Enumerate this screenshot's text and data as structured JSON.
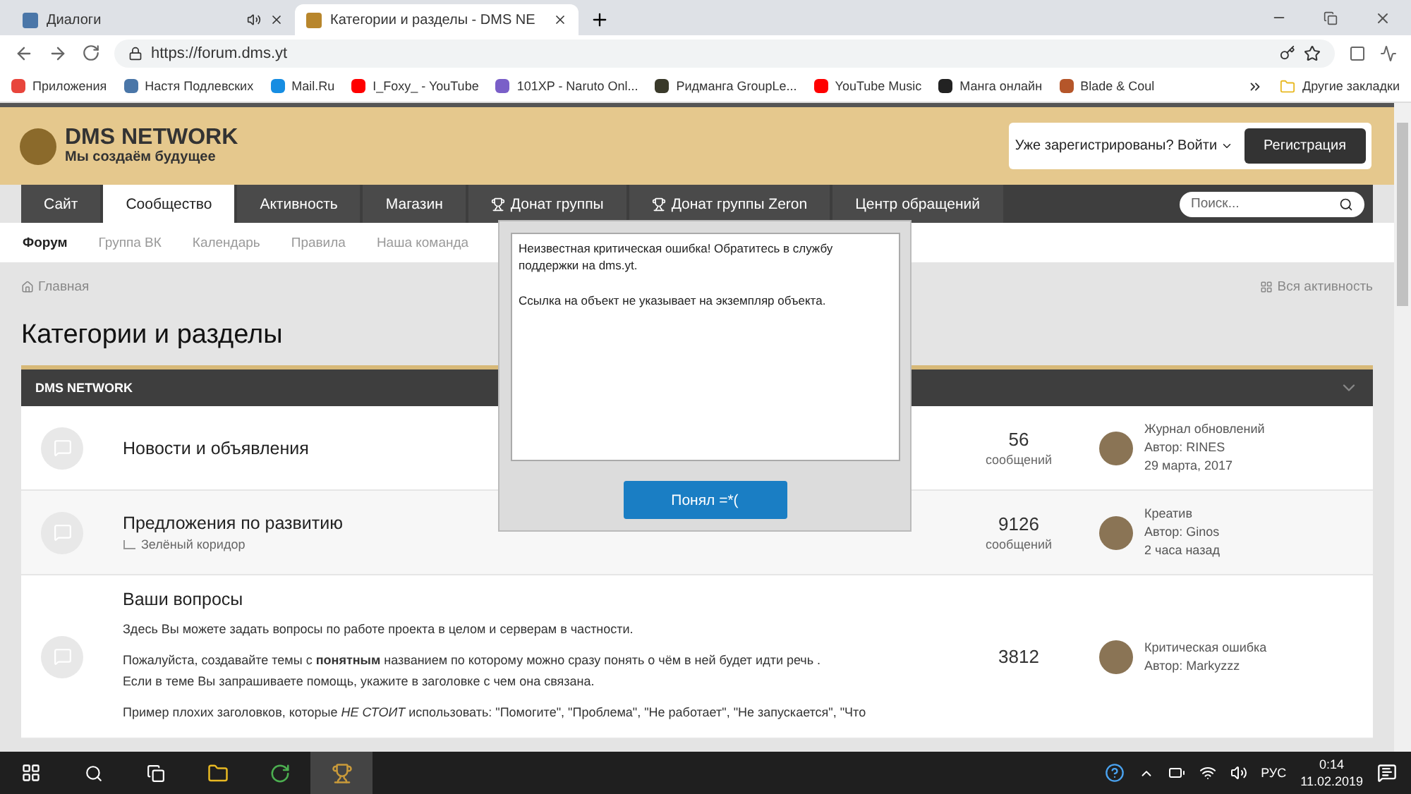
{
  "browser": {
    "tabs": [
      {
        "title": "Диалоги",
        "selected": false,
        "audio": true
      },
      {
        "title": "Категории и разделы - DMS NE",
        "selected": true,
        "audio": false
      }
    ],
    "url": "https://forum.dms.yt",
    "bookmarks": [
      {
        "label": "Приложения",
        "color": "#e8453c"
      },
      {
        "label": "Настя Подлевских",
        "color": "#4a76a8"
      },
      {
        "label": "Mail.Ru",
        "color": "#168de2"
      },
      {
        "label": "I_Foxy_ - YouTube",
        "color": "#ff0000"
      },
      {
        "label": "101XP - Naruto Onl...",
        "color": "#7a5fc8"
      },
      {
        "label": "Ридманга GroupLe...",
        "color": "#3a3a2a"
      },
      {
        "label": "YouTube Music",
        "color": "#ff0000"
      },
      {
        "label": "Манга онлайн",
        "color": "#222222"
      },
      {
        "label": "Blade & Coul",
        "color": "#b5562a"
      }
    ],
    "other_bookmarks": "Другие закладки"
  },
  "site": {
    "logo_title": "DMS NETWORK",
    "logo_subtitle": "Мы создаём будущее",
    "login": "Уже зарегистрированы? Войти",
    "register": "Регистрация",
    "nav": [
      {
        "label": "Сайт",
        "selected": false,
        "cup": false
      },
      {
        "label": "Сообщество",
        "selected": true,
        "cup": false
      },
      {
        "label": "Активность",
        "selected": false,
        "cup": false
      },
      {
        "label": "Магазин",
        "selected": false,
        "cup": false
      },
      {
        "label": "Донат группы",
        "selected": false,
        "cup": true
      },
      {
        "label": "Донат группы Zeron",
        "selected": false,
        "cup": true
      },
      {
        "label": "Центр обращений",
        "selected": false,
        "cup": false
      }
    ],
    "search_placeholder": "Поиск...",
    "subnav": [
      {
        "label": "Форум",
        "selected": true
      },
      {
        "label": "Группа ВК",
        "selected": false
      },
      {
        "label": "Календарь",
        "selected": false
      },
      {
        "label": "Правила",
        "selected": false
      },
      {
        "label": "Наша команда",
        "selected": false
      }
    ],
    "breadcrumb": "Главная",
    "all_activity": "Вся активность",
    "page_title": "Категории и разделы",
    "category": "DMS NETWORK",
    "forums": [
      {
        "title": "Новости и объявления",
        "count": "56",
        "count_label": "сообщений",
        "last_title": "Журнал обновлений",
        "last_author": "Автор: RINES",
        "last_date": "29 марта, 2017"
      },
      {
        "title": "Предложения по развитию",
        "subforum": "Зелёный коридор",
        "count": "9126",
        "count_label": "сообщений",
        "last_title": "Креатив",
        "last_author": "Автор: Ginos",
        "last_date": "2 часа назад"
      },
      {
        "title": "Ваши вопросы",
        "description": [
          "Здесь Вы можете задать вопросы по работе проекта в целом и серверам в частности.",
          "Пожалуйста, создавайте темы с **понятным** названием по которому можно сразу понять о чём в ней будет идти речь .\nЕсли в теме Вы запрашиваете помощь, укажите в заголовке с чем она связана.",
          "Пример плохих заголовков, которые *НЕ СТОИТ* использовать: \"Помогите\",  \"Проблема\", \"Не работает\", \"Не запускается\", \"Что"
        ],
        "count": "3812",
        "last_title": "Критическая ошибка",
        "last_author": "Автор: Markyzzz"
      }
    ]
  },
  "dialog": {
    "message": [
      "Неизвестная критическая ошибка! Обратитесь в службу поддержки на dms.yt.",
      "Ссылка на объект не указывает на экземпляр объекта."
    ],
    "button": "Понял =*("
  },
  "taskbar": {
    "language": "РУС",
    "time": "0:14",
    "date": "11.02.2019"
  }
}
